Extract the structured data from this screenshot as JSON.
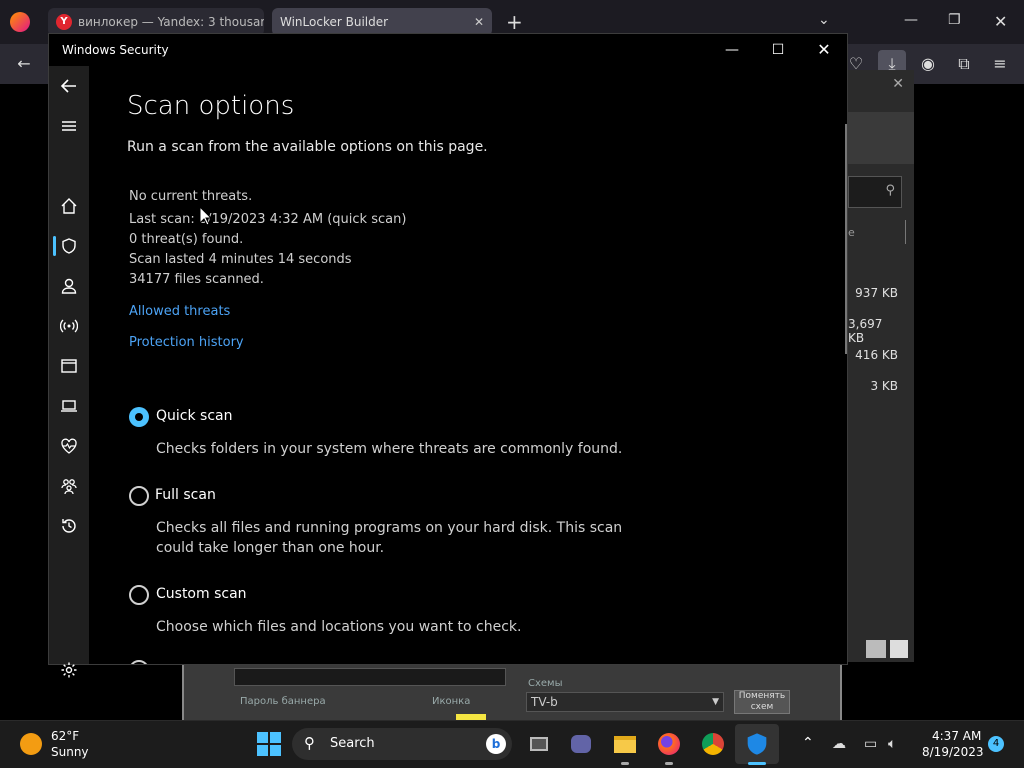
{
  "browser": {
    "tabs": [
      {
        "label": "винлокер — Yandex: 3 thousar"
      },
      {
        "label": "WinLocker Builder"
      }
    ],
    "new_tab_symbol": "+"
  },
  "background_app": {
    "file_sizes": [
      "937 KB",
      "3,697 KB",
      "416 KB",
      "3 KB"
    ],
    "clipped_letter": "e",
    "labels": {
      "banner_password": "Пароль баннера",
      "icon": "Иконка",
      "schemes": "Схемы",
      "change_scheme": "Поменять схем"
    },
    "scheme_value": "TV-b"
  },
  "window": {
    "title": "Windows Security",
    "page_title": "Scan options",
    "subtitle": "Run a scan from the available options on this page.",
    "status": {
      "threats": "No current threats.",
      "last_scan": "Last scan: 8/19/2023 4:32 AM (quick scan)",
      "found": "0 threat(s) found.",
      "duration": "Scan lasted 4 minutes 14 seconds",
      "files": "34177 files scanned."
    },
    "links": {
      "allowed": "Allowed threats",
      "history": "Protection history"
    },
    "options": [
      {
        "label": "Quick scan",
        "desc": "Checks folders in your system where threats are commonly found.",
        "selected": true
      },
      {
        "label": "Full scan",
        "desc": "Checks all files and running programs on your hard disk. This scan could take longer than one hour.",
        "selected": false
      },
      {
        "label": "Custom scan",
        "desc": "Choose which files and locations you want to check.",
        "selected": false
      }
    ]
  },
  "taskbar": {
    "weather_temp": "62°F",
    "weather_desc": "Sunny",
    "search_placeholder": "Search",
    "time": "4:37 AM",
    "date": "8/19/2023",
    "notifications": "4"
  },
  "colors": {
    "accent": "#4cc2ff",
    "link": "#4ca3f5",
    "nav_bg": "#1f1f1f"
  }
}
